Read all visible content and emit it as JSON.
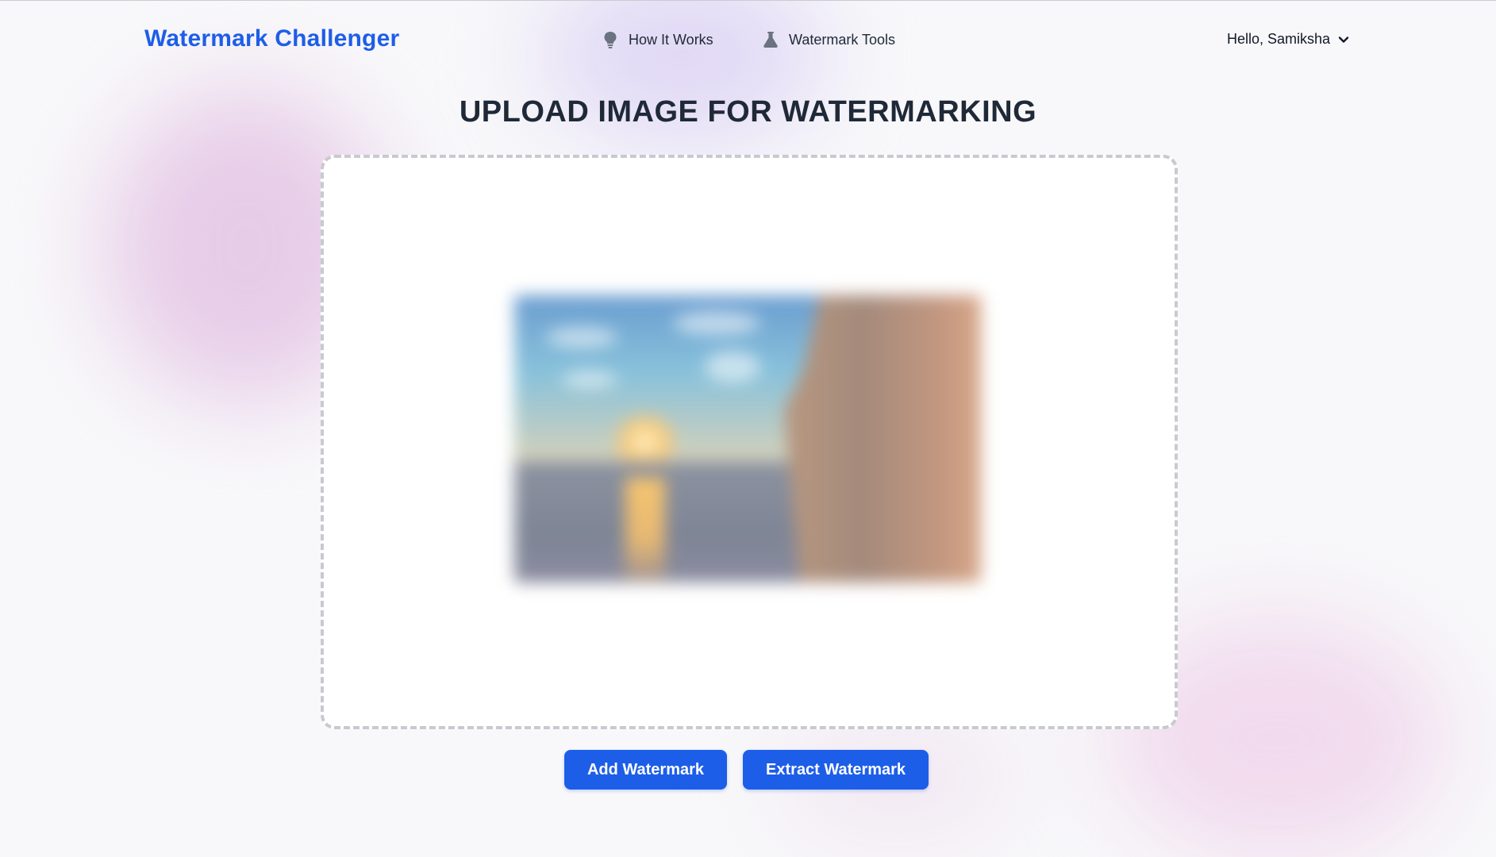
{
  "brand": {
    "name": "Watermark Challenger",
    "color": "#1d5ee8"
  },
  "nav": {
    "links": [
      {
        "label": "How It Works",
        "icon": "lightbulb-icon"
      },
      {
        "label": "Watermark Tools",
        "icon": "flask-icon"
      }
    ],
    "user_greeting": "Hello, Samiksha",
    "user_menu_icon": "chevron-down-icon"
  },
  "main": {
    "title": "UPLOAD IMAGE FOR WATERMARKING",
    "preview_description": "uploaded-image-preview"
  },
  "actions": {
    "add_label": "Add Watermark",
    "extract_label": "Extract Watermark"
  }
}
